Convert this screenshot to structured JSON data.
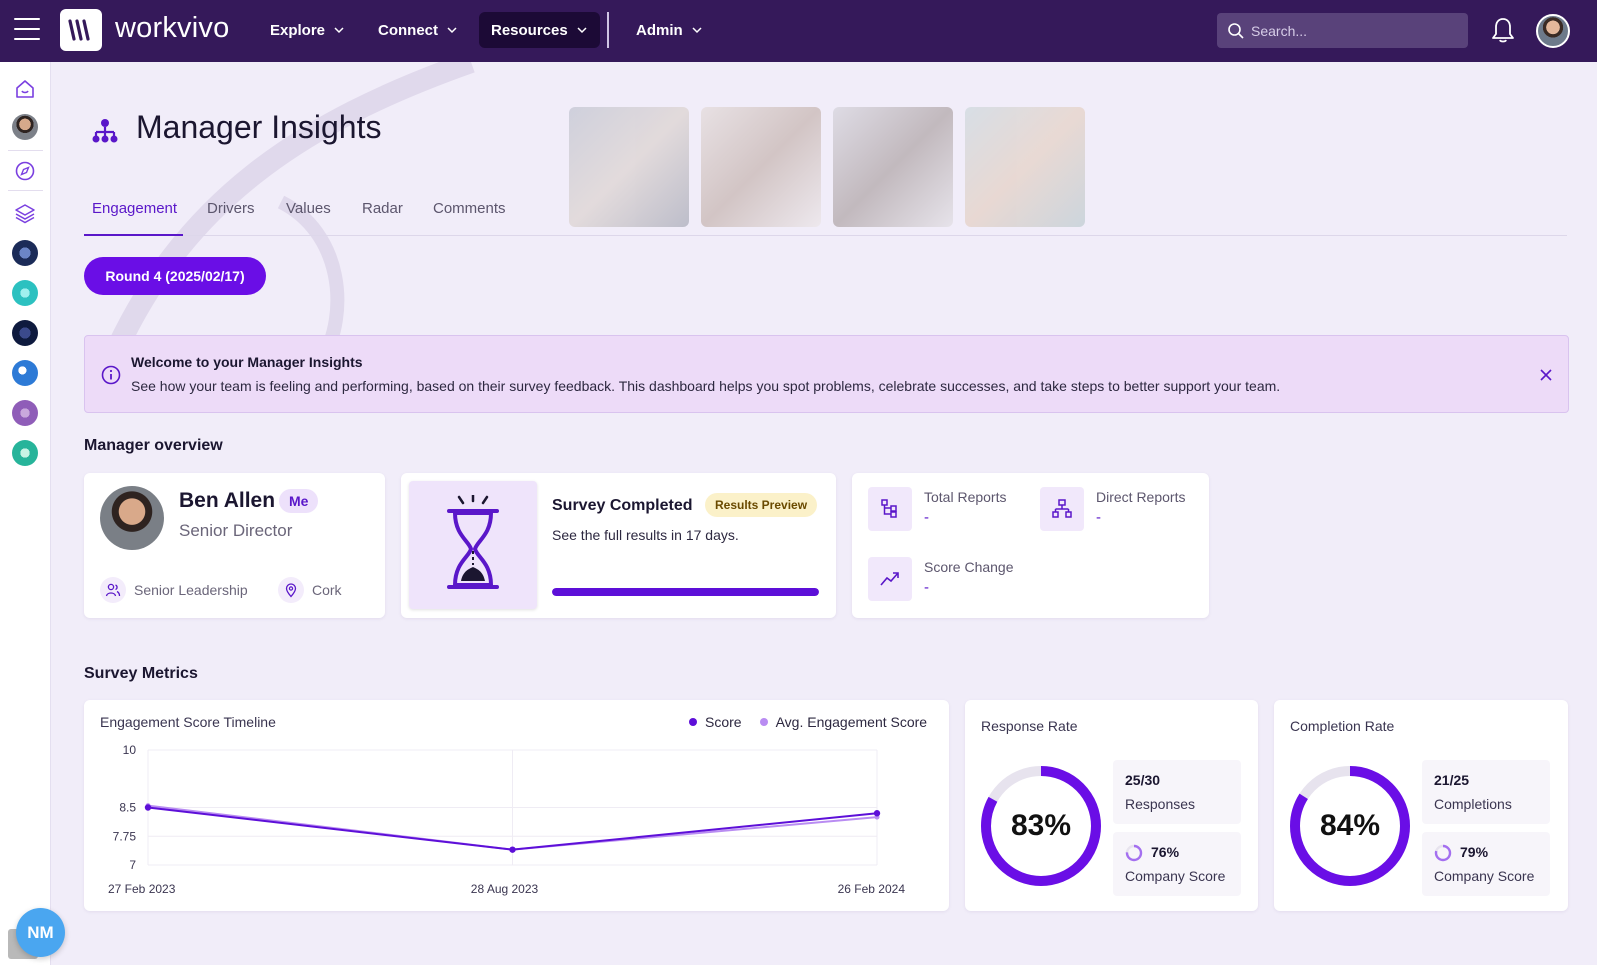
{
  "topbar": {
    "brand": "workvivo",
    "nav": [
      {
        "label": "Explore"
      },
      {
        "label": "Connect"
      },
      {
        "label": "Resources"
      },
      {
        "label": "Admin"
      }
    ],
    "search_placeholder": "Search..."
  },
  "sidebar": {
    "bottom_badge": "NM"
  },
  "page": {
    "title": "Manager Insights",
    "tabs": [
      "Engagement",
      "Drivers",
      "Values",
      "Radar",
      "Comments"
    ],
    "active_tab": "Engagement",
    "round_button": "Round 4 (2025/02/17)"
  },
  "banner": {
    "title": "Welcome to your Manager Insights",
    "text": "See how your team is feeling and performing, based on their survey feedback. This dashboard helps you spot problems, celebrate successes, and take steps to better support your team."
  },
  "manager_overview": {
    "section_title": "Manager overview",
    "name": "Ben Allen",
    "badge": "Me",
    "role": "Senior Director",
    "department": "Senior Leadership",
    "location": "Cork",
    "survey": {
      "title": "Survey Completed",
      "badge": "Results Preview",
      "subtitle": "See the full results in 17 days.",
      "progress": 1.0
    },
    "stats": {
      "total_reports": {
        "label": "Total Reports",
        "value": "-"
      },
      "direct_reports": {
        "label": "Direct Reports",
        "value": "-"
      },
      "score_change": {
        "label": "Score Change",
        "value": "-"
      }
    }
  },
  "survey_metrics": {
    "section_title": "Survey Metrics",
    "legend": {
      "score": "Score",
      "avg": "Avg. Engagement Score"
    },
    "colors": {
      "score": "#5d0fd8",
      "avg": "#b98cf2",
      "accent": "#6a0ee6"
    },
    "response_rate": {
      "title": "Response Rate",
      "percent": "83%",
      "value": 0.83,
      "count": "25/30",
      "count_label": "Responses",
      "company_score": "76%",
      "company_value": 0.76,
      "company_label": "Company Score"
    },
    "completion_rate": {
      "title": "Completion Rate",
      "percent": "84%",
      "value": 0.84,
      "count": "21/25",
      "count_label": "Completions",
      "company_score": "79%",
      "company_value": 0.79,
      "company_label": "Company Score"
    }
  },
  "chart_data": {
    "type": "line",
    "title": "Engagement Score Timeline",
    "categories": [
      "27 Feb 2023",
      "28 Aug 2023",
      "26 Feb 2024"
    ],
    "series": [
      {
        "name": "Score",
        "values": [
          8.5,
          7.4,
          8.35
        ]
      },
      {
        "name": "Avg. Engagement Score",
        "values": [
          8.55,
          7.4,
          8.25
        ]
      }
    ],
    "yticks": [
      "10",
      "8.5",
      "7.75",
      "7"
    ],
    "ylim": [
      7,
      10
    ],
    "grid": true,
    "legend": "top-right"
  }
}
